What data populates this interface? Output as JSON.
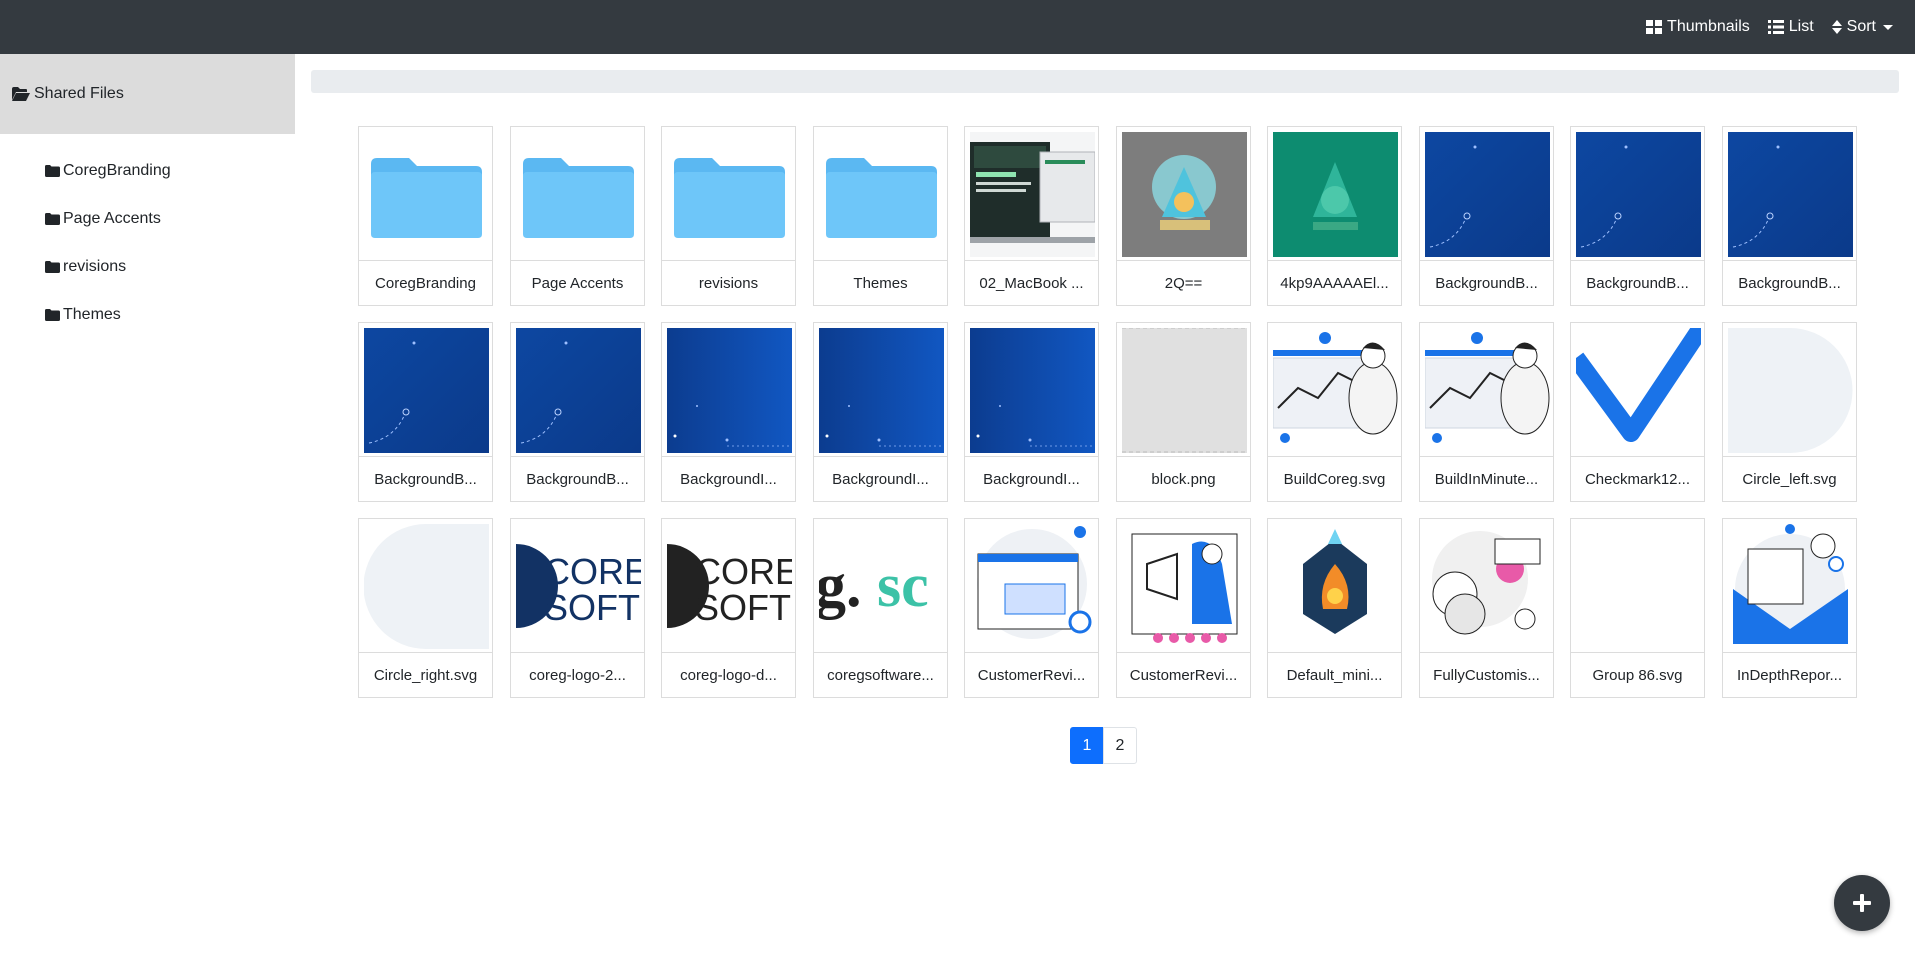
{
  "toolbar": {
    "thumbnails_label": "Thumbnails",
    "list_label": "List",
    "sort_label": "Sort"
  },
  "sidebar": {
    "root_label": "Shared Files",
    "items": [
      {
        "label": "CoregBranding"
      },
      {
        "label": "Page Accents"
      },
      {
        "label": "revisions"
      },
      {
        "label": "Themes"
      }
    ]
  },
  "files": [
    {
      "name": "CoregBranding",
      "thumb": "folder"
    },
    {
      "name": "Page Accents",
      "thumb": "folder"
    },
    {
      "name": "revisions",
      "thumb": "folder"
    },
    {
      "name": "Themes",
      "thumb": "folder"
    },
    {
      "name": "02_MacBook ...",
      "thumb": "laptop"
    },
    {
      "name": "2Q==",
      "thumb": "gray-art"
    },
    {
      "name": "4kp9AAAAAEl...",
      "thumb": "teal-art"
    },
    {
      "name": "BackgroundB...",
      "thumb": "blue-curve"
    },
    {
      "name": "BackgroundB...",
      "thumb": "blue-curve"
    },
    {
      "name": "BackgroundB...",
      "thumb": "blue-curve"
    },
    {
      "name": "BackgroundB...",
      "thumb": "blue-curve"
    },
    {
      "name": "BackgroundB...",
      "thumb": "blue-curve"
    },
    {
      "name": "BackgroundI...",
      "thumb": "blue-dots"
    },
    {
      "name": "BackgroundI...",
      "thumb": "blue-dots"
    },
    {
      "name": "BackgroundI...",
      "thumb": "blue-dots"
    },
    {
      "name": "block.png",
      "thumb": "block"
    },
    {
      "name": "BuildCoreg.svg",
      "thumb": "illustration"
    },
    {
      "name": "BuildInMinute...",
      "thumb": "illustration"
    },
    {
      "name": "Checkmark12...",
      "thumb": "checkmark"
    },
    {
      "name": "Circle_left.svg",
      "thumb": "circle-left"
    },
    {
      "name": "Circle_right.svg",
      "thumb": "circle-right"
    },
    {
      "name": "coreg-logo-2...",
      "thumb": "logo-blue"
    },
    {
      "name": "coreg-logo-d...",
      "thumb": "logo-dark"
    },
    {
      "name": "coregsoftware...",
      "thumb": "gso"
    },
    {
      "name": "CustomerRevi...",
      "thumb": "browser"
    },
    {
      "name": "CustomerRevi...",
      "thumb": "megaphone"
    },
    {
      "name": "Default_mini...",
      "thumb": "fire"
    },
    {
      "name": "FullyCustomis...",
      "thumb": "gears"
    },
    {
      "name": "Group 86.svg",
      "thumb": "empty"
    },
    {
      "name": "InDepthRepor...",
      "thumb": "envelope"
    }
  ],
  "pagination": {
    "pages": [
      "1",
      "2"
    ],
    "current": "1"
  },
  "logo_text": {
    "core": "CORE",
    "soft": "SOFT",
    "g": "g.",
    "sc": "sc"
  },
  "colors": {
    "topbar": "#343a40",
    "folder": "#6ec6f9",
    "accent": "#0d6efd",
    "blue_bg": "#0d3d92"
  }
}
